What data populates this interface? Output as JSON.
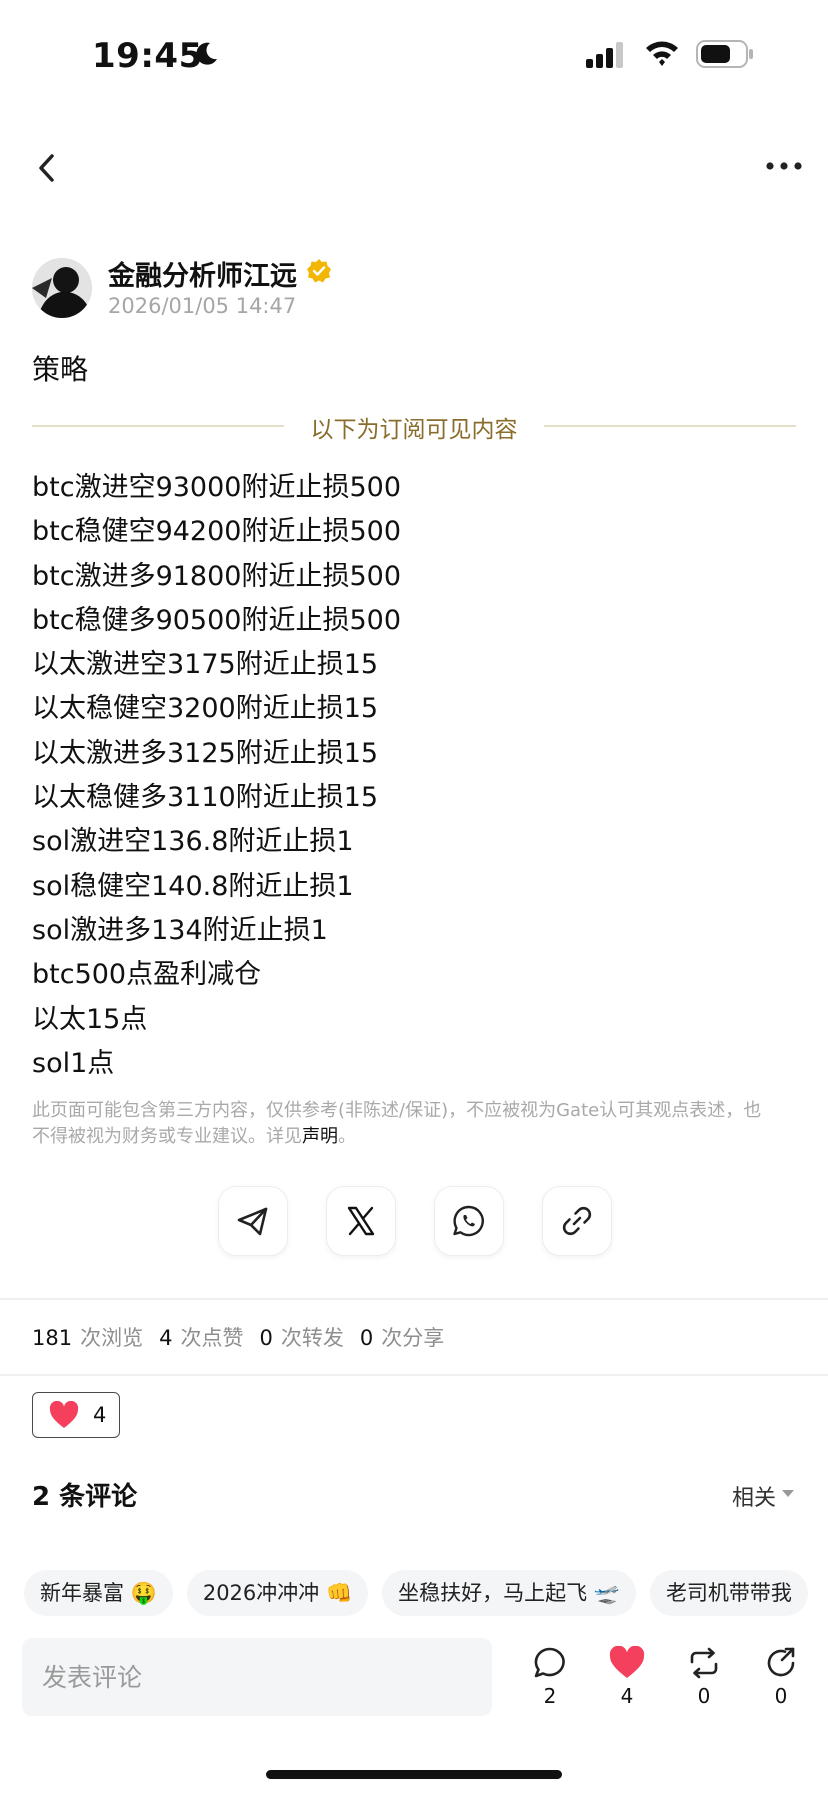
{
  "status_bar": {
    "time": "19:45"
  },
  "author": {
    "name": "金融分析师江远",
    "timestamp": "2026/01/05 14:47"
  },
  "post": {
    "title": "策略",
    "subscription_divider": "以下为订阅可见内容",
    "lines": [
      "btc激进空93000附近止损500",
      "btc稳健空94200附近止损500",
      "btc激进多91800附近止损500",
      "btc稳健多90500附近止损500",
      "以太激进空3175附近止损15",
      "以太稳健空3200附近止损15",
      "以太激进多3125附近止损15",
      "以太稳健多3110附近止损15",
      "sol激进空136.8附近止损1",
      "sol稳健空140.8附近止损1",
      "sol激进多134附近止损1",
      "btc500点盈利减仓",
      "以太15点",
      "sol1点"
    ],
    "disclaimer_text": "此页面可能包含第三方内容，仅供参考(非陈述/保证)，不应被视为Gate认可其观点表述，也不得被视为财务或专业建议。详见",
    "disclaimer_link": "声明",
    "disclaimer_end": "。"
  },
  "share_buttons": [
    {
      "name": "telegram",
      "icon": "telegram-icon"
    },
    {
      "name": "x",
      "icon": "x-icon"
    },
    {
      "name": "whatsapp",
      "icon": "whatsapp-icon"
    },
    {
      "name": "copy-link",
      "icon": "link-icon"
    }
  ],
  "stats": {
    "views": "181",
    "views_label": "次浏览",
    "likes": "4",
    "likes_label": "次点赞",
    "reposts": "0",
    "reposts_label": "次转发",
    "shares": "0",
    "shares_label": "次分享"
  },
  "reaction": {
    "icon": "heart-icon",
    "count": "4"
  },
  "comments": {
    "title": "2 条评论",
    "sort": "相关"
  },
  "quick_replies": [
    "新年暴富 🤑",
    "2026冲冲冲 👊",
    "坐稳扶好，马上起飞 🛫",
    "老司机带带我"
  ],
  "comment_input": {
    "placeholder": "发表评论"
  },
  "actions": {
    "comment_count": "2",
    "like_count": "4",
    "repost_count": "0",
    "share_count": "0"
  },
  "colors": {
    "accent_gold": "#8a6d2c",
    "verified": "#f2b705",
    "heart": "#f4405c"
  }
}
